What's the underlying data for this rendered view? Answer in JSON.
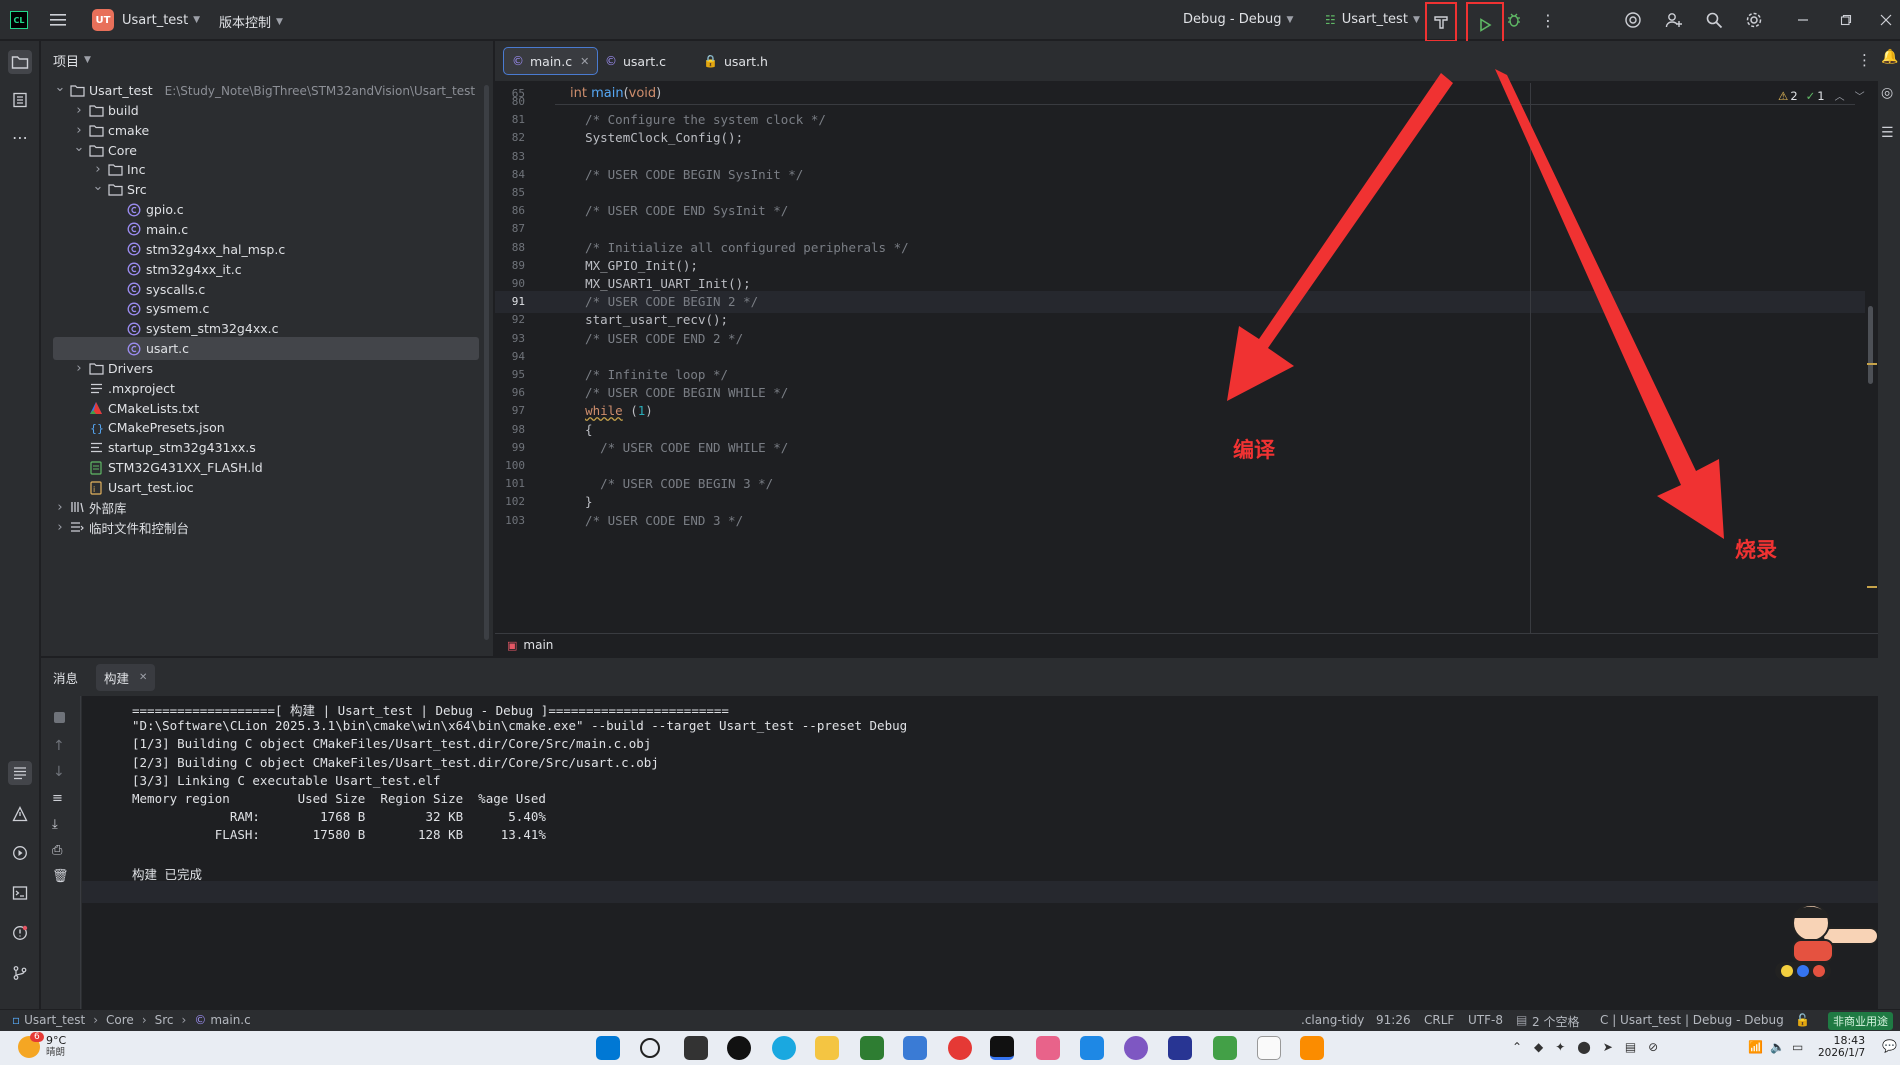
{
  "titlebar": {
    "project_badge": "UT",
    "project_name": "Usart_test",
    "vcs": "版本控制",
    "config": "Debug - Debug",
    "run_target": "Usart_test",
    "accent": "#3574f0"
  },
  "project_panel": {
    "title": "项目",
    "tree": [
      {
        "label": "Usart_test",
        "path": "E:\\Study_Note\\BigThree\\STM32andVision\\Usart_test",
        "icon": "folder-icon",
        "arrow": "expanded",
        "depth": 0
      },
      {
        "label": "build",
        "icon": "folder-icon",
        "arrow": "collapsed",
        "depth": 1
      },
      {
        "label": "cmake",
        "icon": "folder-icon",
        "arrow": "collapsed",
        "depth": 1
      },
      {
        "label": "Core",
        "icon": "folder-icon",
        "arrow": "expanded",
        "depth": 1
      },
      {
        "label": "Inc",
        "icon": "folder-icon",
        "arrow": "collapsed",
        "depth": 2
      },
      {
        "label": "Src",
        "icon": "folder-icon",
        "arrow": "expanded",
        "depth": 2
      },
      {
        "label": "gpio.c",
        "icon": "c-file-icon",
        "arrow": "none",
        "depth": 3
      },
      {
        "label": "main.c",
        "icon": "c-file-icon",
        "arrow": "none",
        "depth": 3
      },
      {
        "label": "stm32g4xx_hal_msp.c",
        "icon": "c-file-icon",
        "arrow": "none",
        "depth": 3
      },
      {
        "label": "stm32g4xx_it.c",
        "icon": "c-file-icon",
        "arrow": "none",
        "depth": 3
      },
      {
        "label": "syscalls.c",
        "icon": "c-file-icon",
        "arrow": "none",
        "depth": 3
      },
      {
        "label": "sysmem.c",
        "icon": "c-file-icon",
        "arrow": "none",
        "depth": 3
      },
      {
        "label": "system_stm32g4xx.c",
        "icon": "c-file-icon",
        "arrow": "none",
        "depth": 3
      },
      {
        "label": "usart.c",
        "icon": "c-file-icon",
        "arrow": "none",
        "depth": 3,
        "selected": true
      },
      {
        "label": "Drivers",
        "icon": "folder-icon",
        "arrow": "collapsed",
        "depth": 1
      },
      {
        "label": ".mxproject",
        "icon": "text-file-icon",
        "arrow": "none",
        "depth": 1
      },
      {
        "label": "CMakeLists.txt",
        "icon": "cmake-icon",
        "arrow": "none",
        "depth": 1
      },
      {
        "label": "CMakePresets.json",
        "icon": "json-icon",
        "arrow": "none",
        "depth": 1
      },
      {
        "label": "startup_stm32g431xx.s",
        "icon": "asm-file-icon",
        "arrow": "none",
        "depth": 1
      },
      {
        "label": "STM32G431XX_FLASH.ld",
        "icon": "ld-file-icon",
        "arrow": "none",
        "depth": 1
      },
      {
        "label": "Usart_test.ioc",
        "icon": "ioc-file-icon",
        "arrow": "none",
        "depth": 1
      },
      {
        "label": "外部库",
        "icon": "library-icon",
        "arrow": "collapsed",
        "depth": 0
      },
      {
        "label": "临时文件和控制台",
        "icon": "scratch-icon",
        "arrow": "collapsed",
        "depth": 0
      }
    ]
  },
  "editor": {
    "tabs": [
      {
        "label": "main.c",
        "active": true
      },
      {
        "label": "usart.c",
        "active": false
      },
      {
        "label": "usart.h",
        "active": false
      }
    ],
    "sticky_line": {
      "num": "65",
      "text": "int main(void)"
    },
    "inspection": {
      "warnings": "2",
      "ok": "1"
    },
    "lines": [
      {
        "num": "80",
        "text": ""
      },
      {
        "num": "81",
        "text": "  /* Configure the system clock */",
        "kind": "comment"
      },
      {
        "num": "82",
        "text": "  SystemClock_Config();",
        "kind": "call"
      },
      {
        "num": "83",
        "text": ""
      },
      {
        "num": "84",
        "text": "  /* USER CODE BEGIN SysInit */",
        "kind": "comment"
      },
      {
        "num": "85",
        "text": ""
      },
      {
        "num": "86",
        "text": "  /* USER CODE END SysInit */",
        "kind": "comment"
      },
      {
        "num": "87",
        "text": ""
      },
      {
        "num": "88",
        "text": "  /* Initialize all configured peripherals */",
        "kind": "comment"
      },
      {
        "num": "89",
        "text": "  MX_GPIO_Init();",
        "kind": "call"
      },
      {
        "num": "90",
        "text": "  MX_USART1_UART_Init();",
        "kind": "call"
      },
      {
        "num": "91",
        "text": "  /* USER CODE BEGIN 2 */",
        "kind": "comment",
        "current": true
      },
      {
        "num": "92",
        "text": "  start_usart_recv();",
        "kind": "call"
      },
      {
        "num": "93",
        "text": "  /* USER CODE END 2 */",
        "kind": "comment"
      },
      {
        "num": "94",
        "text": ""
      },
      {
        "num": "95",
        "text": "  /* Infinite loop */",
        "kind": "comment"
      },
      {
        "num": "96",
        "text": "  /* USER CODE BEGIN WHILE */",
        "kind": "comment"
      },
      {
        "num": "97",
        "text": "  while (1)",
        "kind": "while"
      },
      {
        "num": "98",
        "text": "  {",
        "kind": "plain"
      },
      {
        "num": "99",
        "text": "    /* USER CODE END WHILE */",
        "kind": "comment"
      },
      {
        "num": "100",
        "text": ""
      },
      {
        "num": "101",
        "text": "    /* USER CODE BEGIN 3 */",
        "kind": "comment"
      },
      {
        "num": "102",
        "text": "  }",
        "kind": "plain"
      },
      {
        "num": "103",
        "text": "  /* USER CODE END 3 */",
        "kind": "comment"
      }
    ],
    "breadcrumb_fn": "main"
  },
  "annotations": {
    "compile": "编译",
    "flash": "烧录",
    "color": "#f03232"
  },
  "bottom_panel": {
    "title": "消息",
    "tab": "构建",
    "console": [
      "===================[ 构建 | Usart_test | Debug - Debug ]========================",
      "\"D:\\Software\\CLion 2025.3.1\\bin\\cmake\\win\\x64\\bin\\cmake.exe\" --build --target Usart_test --preset Debug",
      "[1/3] Building C object CMakeFiles/Usart_test.dir/Core/Src/main.c.obj",
      "[2/3] Building C object CMakeFiles/Usart_test.dir/Core/Src/usart.c.obj",
      "[3/3] Linking C executable Usart_test.elf",
      "Memory region         Used Size  Region Size  %age Used",
      "             RAM:        1768 B        32 KB      5.40%",
      "           FLASH:       17580 B       128 KB     13.41%",
      "",
      "构建 已完成"
    ]
  },
  "statusbar": {
    "crumbs": [
      "Usart_test",
      "Core",
      "Src",
      "main.c"
    ],
    "linter": ".clang-tidy",
    "position": "91:26",
    "line_ending": "CRLF",
    "encoding": "UTF-8",
    "indent": "2 个空格",
    "context": "C | Usart_test | Debug - Debug",
    "license": "非商业用途"
  },
  "taskbar": {
    "weather_temp": "9°C",
    "weather_desc": "晴朗",
    "weather_badge": "6",
    "time": "18:43",
    "date": "2026/1/7"
  }
}
